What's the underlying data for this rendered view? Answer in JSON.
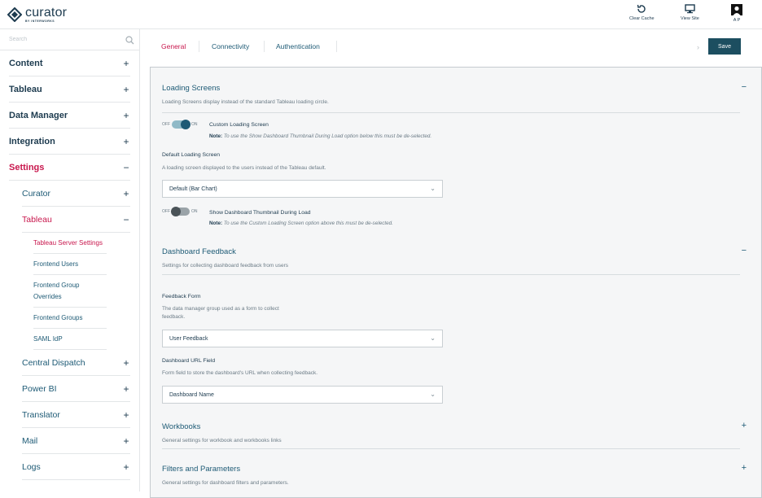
{
  "header": {
    "logo_name": "curator",
    "logo_sub": "BY INTERWORKS",
    "actions": [
      {
        "label": "Clear Cache",
        "icon": "refresh-icon"
      },
      {
        "label": "View Site",
        "icon": "monitor-icon"
      },
      {
        "label": "A P",
        "icon": "avatar-icon"
      }
    ]
  },
  "sidebar": {
    "search_placeholder": "Search",
    "items": [
      {
        "label": "Content",
        "toggle": "+"
      },
      {
        "label": "Tableau",
        "toggle": "+"
      },
      {
        "label": "Data Manager",
        "toggle": "+"
      },
      {
        "label": "Integration",
        "toggle": "+"
      },
      {
        "label": "Settings",
        "toggle": "−"
      }
    ],
    "sub_items": [
      {
        "label": "Curator",
        "toggle": "+"
      },
      {
        "label": "Tableau",
        "toggle": "−"
      }
    ],
    "leaf_items": [
      {
        "label": "Tableau Server Settings"
      },
      {
        "label": "Frontend Users"
      },
      {
        "label": "Frontend Group Overrides"
      },
      {
        "label": "Frontend Groups"
      },
      {
        "label": "SAML IdP"
      }
    ],
    "more_sub_items": [
      {
        "label": "Central Dispatch",
        "toggle": "+"
      },
      {
        "label": "Power BI",
        "toggle": "+"
      },
      {
        "label": "Translator",
        "toggle": "+"
      },
      {
        "label": "Mail",
        "toggle": "+"
      },
      {
        "label": "Logs",
        "toggle": "+"
      }
    ]
  },
  "tabs": {
    "items": [
      "General",
      "Connectivity",
      "Authentication"
    ],
    "chevron": "›",
    "save_label": "Save"
  },
  "loading": {
    "title": "Loading Screens",
    "toggle": "−",
    "desc": "Loading Screens display instead of the standard Tableau loading circle.",
    "custom": {
      "off": "OFF",
      "on": "ON",
      "label": "Custom Loading Screen",
      "note_prefix": "Note:",
      "note": " To use the Show Dashboard Thumbnail During Load option below this must be de-selected."
    },
    "default_label": "Default Loading Screen",
    "default_desc": "A loading screen displayed to the users instead of the Tableau default.",
    "default_value": "Default (Bar Chart)",
    "thumb": {
      "off": "OFF",
      "on": "ON",
      "label": "Show Dashboard Thumbnail During Load",
      "note_prefix": "Note:",
      "note": " To use the Custom Loading Screen option above this must be de-selected."
    }
  },
  "feedback": {
    "title": "Dashboard Feedback",
    "toggle": "−",
    "desc": "Settings for collecting dashboard feedback from users",
    "form_label": "Feedback Form",
    "form_desc_1": "The data manager group used as a form to collect",
    "form_desc_2": "feedback.",
    "form_value": "User Feedback",
    "url_label": "Dashboard URL Field",
    "url_desc": "Form field to store the dashboard's URL when collecting feedback.",
    "url_value": "Dashboard Name"
  },
  "workbooks": {
    "title": "Workbooks",
    "toggle": "+",
    "desc": "General settings for workbook and workbooks links"
  },
  "filters": {
    "title": "Filters and Parameters",
    "toggle": "+",
    "desc": "General settings for dashboard filters and parameters."
  }
}
